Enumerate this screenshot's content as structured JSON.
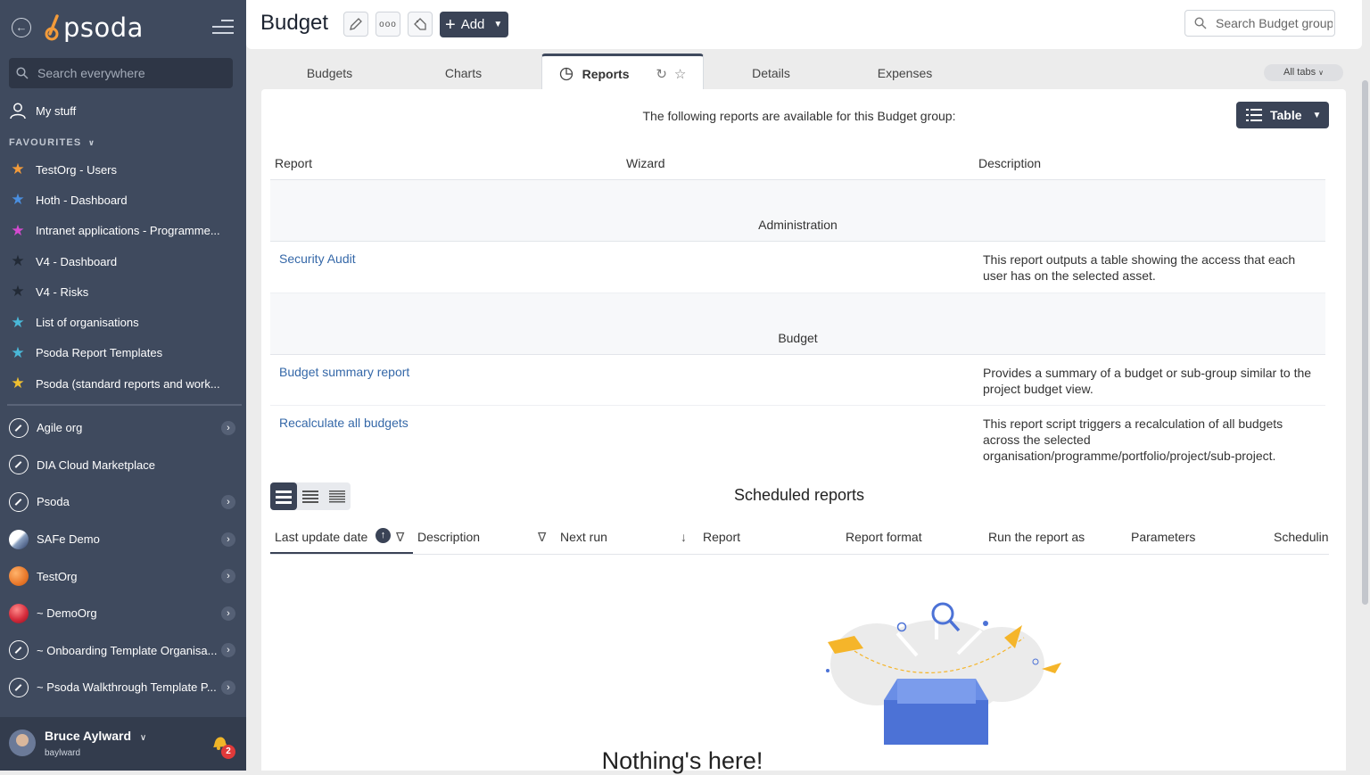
{
  "sidebar": {
    "logo_text": "psoda",
    "search_placeholder": "Search everywhere",
    "my_stuff": "My stuff",
    "favourites_heading": "FAVOURITES",
    "favourites": [
      {
        "label": "TestOrg - Users",
        "color": "#f39b3a"
      },
      {
        "label": "Hoth - Dashboard",
        "color": "#4a8fe0"
      },
      {
        "label": "Intranet applications - Programme...",
        "color": "#d44ad0"
      },
      {
        "label": "V4 - Dashboard",
        "color": "#222a36"
      },
      {
        "label": "V4 - Risks",
        "color": "#222a36"
      },
      {
        "label": "List of organisations",
        "color": "#4ab8d8"
      },
      {
        "label": "Psoda Report Templates",
        "color": "#4ab8d8"
      },
      {
        "label": "Psoda (standard reports and work...",
        "color": "#f0c030"
      }
    ],
    "orgs": [
      {
        "label": "Agile org",
        "icon": "compass-icon",
        "chevron": true
      },
      {
        "label": "DIA Cloud Marketplace",
        "icon": "compass-icon",
        "chevron": false
      },
      {
        "label": "Psoda",
        "icon": "compass-icon",
        "chevron": true
      },
      {
        "label": "SAFe Demo",
        "icon": "safe-logo-icon",
        "chevron": true
      },
      {
        "label": "TestOrg",
        "icon": "orange-ball-icon",
        "chevron": true
      },
      {
        "label": "~ DemoOrg",
        "icon": "red-ball-icon",
        "chevron": true
      },
      {
        "label": "~ Onboarding Template Organisa...",
        "icon": "compass-icon",
        "chevron": true
      },
      {
        "label": "~ Psoda Walkthrough Template P...",
        "icon": "compass-icon",
        "chevron": true
      }
    ],
    "user": {
      "name": "Bruce Aylward",
      "login": "baylward",
      "notifications": "2"
    }
  },
  "header": {
    "title": "Budget",
    "add_label": "Add",
    "search_placeholder": "Search Budget group"
  },
  "tabs": [
    {
      "label": "Budgets"
    },
    {
      "label": "Charts"
    },
    {
      "label": "Reports"
    },
    {
      "label": "Details"
    },
    {
      "label": "Expenses"
    }
  ],
  "all_tabs_label": "All tabs",
  "reports": {
    "intro": "The following reports are available for this Budget group:",
    "view_button": "Table",
    "columns": [
      "Report",
      "Wizard",
      "Description"
    ],
    "groups": [
      {
        "name": "Administration",
        "rows": [
          {
            "report": "Security Audit",
            "description": "This report outputs a table showing the access that each user has on the selected asset."
          }
        ]
      },
      {
        "name": "Budget",
        "rows": [
          {
            "report": "Budget summary report",
            "description": "Provides a summary of a budget or sub-group similar to the project budget view."
          },
          {
            "report": "Recalculate all budgets",
            "description": "This report script triggers a recalculation of all budgets across the selected organisation/programme/portfolio/project/sub-project."
          }
        ]
      }
    ]
  },
  "scheduled": {
    "title": "Scheduled reports",
    "columns": [
      "Last update date",
      "Description",
      "Next run",
      "Report",
      "Report format",
      "Run the report as",
      "Parameters",
      "Schedulin"
    ],
    "empty_message": "Nothing's here!"
  }
}
